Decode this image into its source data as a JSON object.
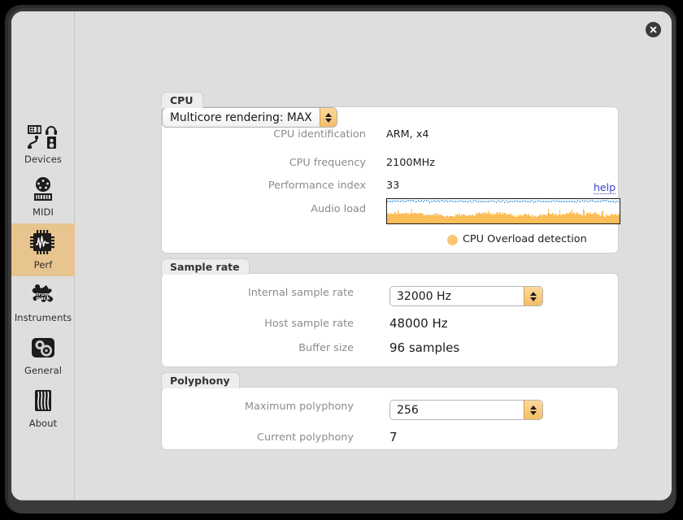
{
  "window": {
    "close_label": "close"
  },
  "sidebar": {
    "items": [
      {
        "id": "devices",
        "label": "Devices",
        "icon": "devices-icon",
        "selected": false
      },
      {
        "id": "midi",
        "label": "MIDI",
        "icon": "midi-din-icon",
        "selected": false
      },
      {
        "id": "perf",
        "label": "Perf",
        "icon": "cpu-chip-icon",
        "selected": true
      },
      {
        "id": "instruments",
        "label": "Instruments",
        "icon": "puzzle-piece-icon",
        "selected": false
      },
      {
        "id": "general",
        "label": "General",
        "icon": "knobs-icon",
        "selected": false
      },
      {
        "id": "about",
        "label": "About",
        "icon": "strings-icon",
        "selected": false
      }
    ]
  },
  "cpu": {
    "title": "CPU",
    "identification_label": "CPU identification",
    "identification_value": "ARM, x4",
    "frequency_label": "CPU frequency",
    "frequency_value": "2100MHz",
    "performance_label": "Performance index",
    "performance_value": "33",
    "help_label": "help",
    "audio_load_label": "Audio load",
    "multicore_value": "Multicore rendering: MAX",
    "overload_label": "CPU Overload detection",
    "overload_color": "#fcc672",
    "meter_bar_color": "#fcbe59",
    "meter_peak_color": "#4a9ee0"
  },
  "sample_rate": {
    "title": "Sample rate",
    "internal_label": "Internal sample rate",
    "internal_value": "32000 Hz",
    "host_label": "Host sample rate",
    "host_value": "48000 Hz",
    "buffer_label": "Buffer size",
    "buffer_value": "96 samples"
  },
  "polyphony": {
    "title": "Polyphony",
    "maximum_label": "Maximum polyphony",
    "maximum_value": "256",
    "current_label": "Current polyphony",
    "current_value": "7"
  }
}
